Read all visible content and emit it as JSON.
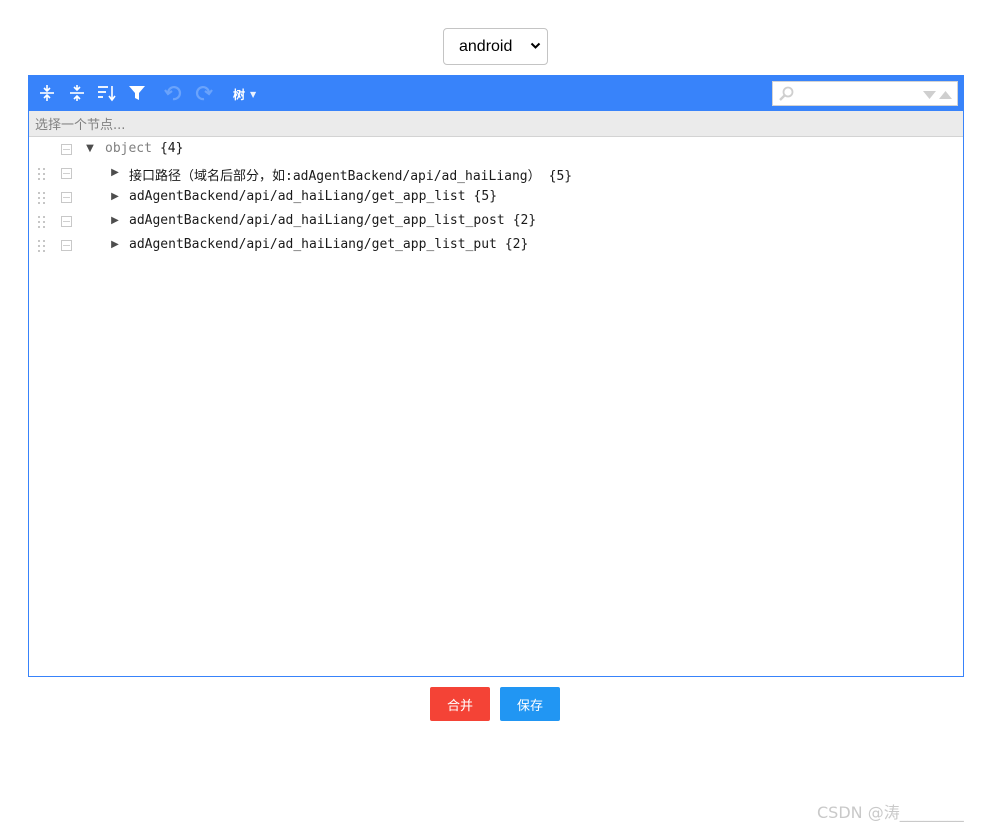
{
  "platform_select": {
    "value": "android"
  },
  "toolbar": {
    "icons": [
      "expand-all-icon",
      "collapse-all-icon",
      "sort-icon",
      "filter-icon",
      "undo-icon",
      "redo-icon"
    ],
    "mode_label": "树",
    "search": {
      "value": ""
    }
  },
  "navbar": {
    "placeholder": "选择一个节点..."
  },
  "tree": {
    "root": {
      "key": "object",
      "count": "{4}"
    },
    "children": [
      {
        "key": "接口路径（域名后部分，如:adAgentBackend/api/ad_haiLiang）",
        "count": "{5}"
      },
      {
        "key": "adAgentBackend/api/ad_haiLiang/get_app_list",
        "count": "{5}"
      },
      {
        "key": "adAgentBackend/api/ad_haiLiang/get_app_list_post",
        "count": "{2}"
      },
      {
        "key": "adAgentBackend/api/ad_haiLiang/get_app_list_put",
        "count": "{2}"
      }
    ]
  },
  "buttons": {
    "merge": "合并",
    "save": "保存"
  },
  "watermark": "CSDN @涛________",
  "colors": {
    "menu": "#3883fa",
    "merge": "#f44336",
    "save": "#2196f3"
  }
}
